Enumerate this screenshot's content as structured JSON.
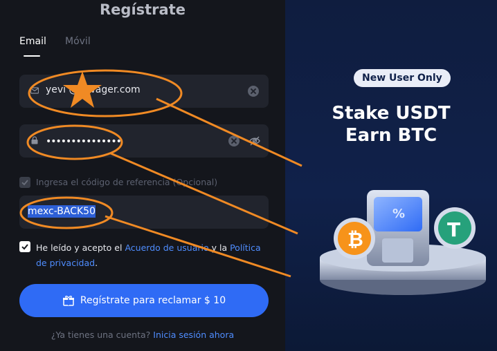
{
  "form": {
    "title": "Regístrate",
    "tabs": [
      {
        "label": "Email"
      },
      {
        "label": "Móvil"
      }
    ],
    "email_value": "yevi   @idwager.com",
    "password_value": "•••••••••••••••",
    "referral_label": "Ingresa el código de referencia (Opcional)",
    "referral_value": "mexc-BACK50",
    "terms_prefix": "He leído y acepto el ",
    "terms_link1": "Acuerdo de usuario",
    "terms_middle": " y la ",
    "terms_link2": "Política de privacidad",
    "terms_suffix": ".",
    "cta_label": "Regístrate para reclamar $ 10",
    "login_question": "¿Ya tienes una cuenta?",
    "login_link": "Inicia sesión ahora"
  },
  "promo": {
    "badge": "New User Only",
    "line1": "Stake USDT",
    "line2": "Earn BTC"
  },
  "colors": {
    "accent": "#2f6bf5",
    "link": "#4f8dff",
    "annotation": "#f08a24",
    "btc": "#f7931a",
    "usdt": "#26a17b"
  },
  "icons": [
    "mail-icon",
    "lock-icon",
    "clear-icon",
    "eye-off-icon",
    "checkbox-icon",
    "gift-icon",
    "bitcoin-icon",
    "tether-icon",
    "star-icon"
  ]
}
